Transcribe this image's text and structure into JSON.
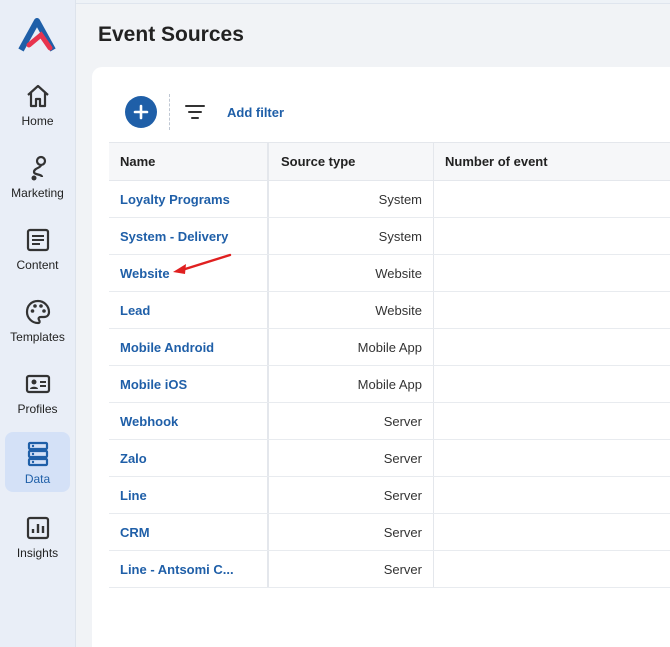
{
  "page": {
    "title": "Event Sources"
  },
  "sidebar": {
    "items": [
      {
        "label": "Home",
        "icon": "home-icon"
      },
      {
        "label": "Marketing",
        "icon": "journey-icon"
      },
      {
        "label": "Content",
        "icon": "document-icon"
      },
      {
        "label": "Templates",
        "icon": "palette-icon"
      },
      {
        "label": "Profiles",
        "icon": "profile-card-icon"
      },
      {
        "label": "Data",
        "icon": "database-icon",
        "active": true
      },
      {
        "label": "Insights",
        "icon": "chart-icon"
      }
    ]
  },
  "toolbar": {
    "add_filter_label": "Add filter"
  },
  "table": {
    "headers": {
      "name": "Name",
      "source_type": "Source type",
      "number_of_event": "Number of event"
    },
    "rows": [
      {
        "name": "Loyalty Programs",
        "source_type": "System"
      },
      {
        "name": "System - Delivery",
        "source_type": "System"
      },
      {
        "name": "Website",
        "source_type": "Website"
      },
      {
        "name": "Lead",
        "source_type": "Website"
      },
      {
        "name": "Mobile Android",
        "source_type": "Mobile App"
      },
      {
        "name": "Mobile iOS",
        "source_type": "Mobile App"
      },
      {
        "name": "Webhook",
        "source_type": "Server"
      },
      {
        "name": "Zalo",
        "source_type": "Server"
      },
      {
        "name": "Line",
        "source_type": "Server"
      },
      {
        "name": "CRM",
        "source_type": "Server"
      },
      {
        "name": "Line - Antsomi C...",
        "source_type": "Server"
      }
    ]
  },
  "colors": {
    "accent": "#1f5fa8",
    "annotation_arrow": "#e02020"
  }
}
